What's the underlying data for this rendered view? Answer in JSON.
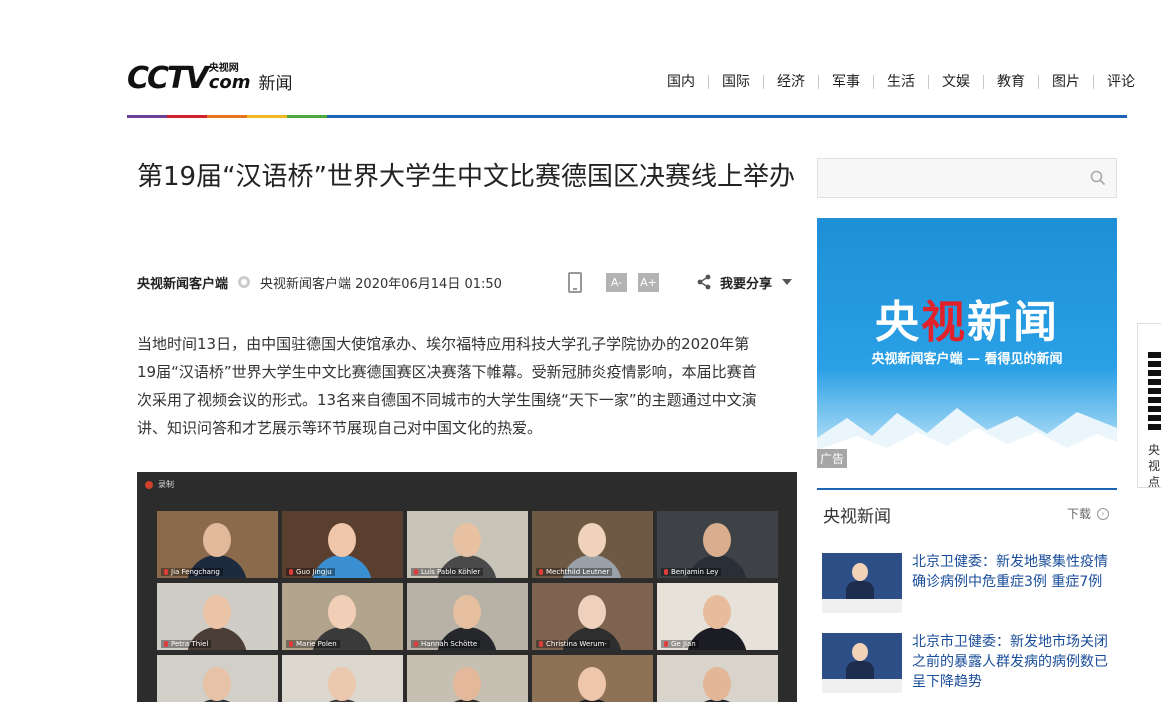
{
  "header": {
    "logo_text": "CCTV",
    "logo_cn": "央视网",
    "logo_com": "com",
    "section": "新闻",
    "nav": [
      "国内",
      "国际",
      "经济",
      "军事",
      "生活",
      "文娱",
      "教育",
      "图片",
      "评论"
    ]
  },
  "article": {
    "title": "第19届“汉语桥”世界大学生中文比赛德国区决赛线上举办",
    "source": "央视新闻客户端",
    "info": "央视新闻客户端 2020年06月14日 01:50",
    "font_small": "A-",
    "font_large": "A+",
    "share_label": "我要分享",
    "paragraph": [
      "当地时间13日，由中国驻德国大使馆承办、埃尔福特应用科技大学孔子学院协办的2020年第",
      "19届“汉语桥”世界大学生中文比赛德国赛区决赛落下帷幕。受新冠肺炎疫情影响，本届比赛首",
      "次采用了视频会议的形式。13名来自德国不同城市的大学生围绕“天下一家”的主题通过中文演",
      "讲、知识问答和才艺展示等环节展现自己对中国文化的热爱。"
    ]
  },
  "video": {
    "record_label": "录制",
    "participants": [
      {
        "name": "Jia Fengchang",
        "bg": "#8a6a4a",
        "skin": "#e2b99a",
        "shirt": "#1e2a3e"
      },
      {
        "name": "Guo Jingju",
        "bg": "#5a3e2e",
        "skin": "#efc6aa",
        "shirt": "#3a8fd0"
      },
      {
        "name": "Luis Pablo Köhler",
        "bg": "#c9c4b8",
        "skin": "#e8c1a2",
        "shirt": "#4a4a4a"
      },
      {
        "name": "Mechthild Leutner",
        "bg": "#6e5a44",
        "skin": "#f0d2bc",
        "shirt": "#9aa0a8"
      },
      {
        "name": "Benjamin Ley",
        "bg": "#3e4246",
        "skin": "#d9ae8e",
        "shirt": "#2a2e36"
      },
      {
        "name": "Petra Thiel",
        "bg": "#cfcdc6",
        "skin": "#ecc4a8",
        "shirt": "#4a3e36"
      },
      {
        "name": "Marie Polen",
        "bg": "#b3a48e",
        "skin": "#f0cfb6",
        "shirt": "#3a3a3a"
      },
      {
        "name": "Hannah Schötte",
        "bg": "#b8b2a6",
        "skin": "#e6bea0",
        "shirt": "#25272b"
      },
      {
        "name": "Christina Werum-",
        "bg": "#7e6450",
        "skin": "#efd0bd",
        "shirt": "#2e2e2e"
      },
      {
        "name": "Ge Jian",
        "bg": "#e6e2da",
        "skin": "#e6bc9c",
        "shirt": "#1c1c24"
      },
      {
        "name": "",
        "bg": "#d2cfc8",
        "skin": "#e8c2a6",
        "shirt": "#30343a"
      },
      {
        "name": "",
        "bg": "#dcd8d0",
        "skin": "#ecc8ae",
        "shirt": "#3c3c3c"
      },
      {
        "name": "",
        "bg": "#c6c0b2",
        "skin": "#e4b89a",
        "shirt": "#2e2a28"
      },
      {
        "name": "",
        "bg": "#8e7256",
        "skin": "#eec7aa",
        "shirt": "#1e1e1e"
      },
      {
        "name": "",
        "bg": "#d8d4cc",
        "skin": "#e2b696",
        "shirt": "#262a30"
      }
    ]
  },
  "sidebar": {
    "ad": {
      "title_a": "央",
      "title_b": "视",
      "title_c": "新闻",
      "slogan": "央视新闻客户端 — 看得见的新闻",
      "tag": "广告"
    },
    "section_title": "央视新闻",
    "download": "下载",
    "news": [
      {
        "title": "北京卫健委：新发地聚集性疫情确诊病例中危重症3例 重症7例"
      },
      {
        "title": "北京市卫健委：新发地市场关闭之前的暴露人群发病的病例数已呈下降趋势"
      }
    ],
    "float_label": "央视点"
  },
  "colors": {
    "accent_blue": "#1f64b4",
    "link_blue": "#1a4d9a",
    "cctv_red": "#c8161e"
  }
}
